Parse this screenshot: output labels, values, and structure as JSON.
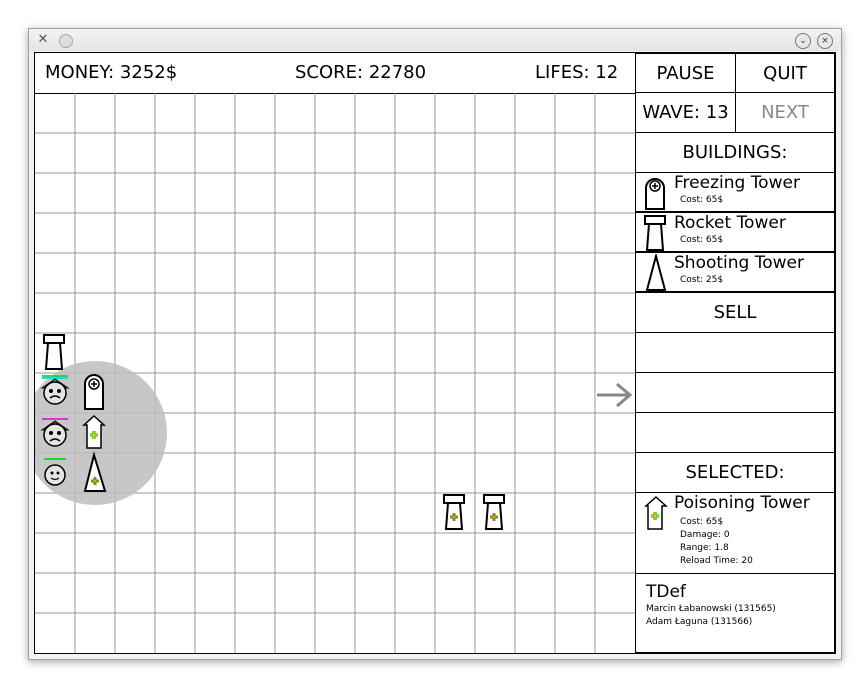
{
  "window": {
    "app_icon": "app-icon",
    "minimize_glyph": "⌄",
    "close_glyph": "×"
  },
  "status": {
    "money": "MONEY: 3252$",
    "score": "SCORE: 22780",
    "lifes": "LIFES: 12"
  },
  "controls": {
    "pause": "PAUSE",
    "quit": "QUIT",
    "wave": "WAVE: 13",
    "next": "NEXT"
  },
  "buildings": {
    "header": "BUILDINGS:",
    "items": [
      {
        "name": "Freezing Tower",
        "cost": "Cost: 65$",
        "icon": "freezing-tower-icon"
      },
      {
        "name": "Rocket Tower",
        "cost": "Cost: 65$",
        "icon": "rocket-tower-icon"
      },
      {
        "name": "Shooting Tower",
        "cost": "Cost: 25$",
        "icon": "shooting-tower-icon"
      }
    ],
    "sell": "SELL"
  },
  "selected": {
    "header": "SELECTED:",
    "name": "Poisoning Tower",
    "cost": "Cost: 65$",
    "damage": "Damage: 0",
    "range": "Range: 1.8",
    "reload": "Reload Time: 20",
    "icon": "poisoning-tower-icon"
  },
  "credits": {
    "title": "TDef",
    "author1": "Marcin Łabanowski (131565)",
    "author2": "Adam Łaguna (131566)"
  },
  "colors": {
    "grid_line": "#999999",
    "range_circle": "#bdbdbd",
    "disabled_text": "#888888",
    "cross": "#f5e100",
    "cross_green": "#1aa31a"
  }
}
